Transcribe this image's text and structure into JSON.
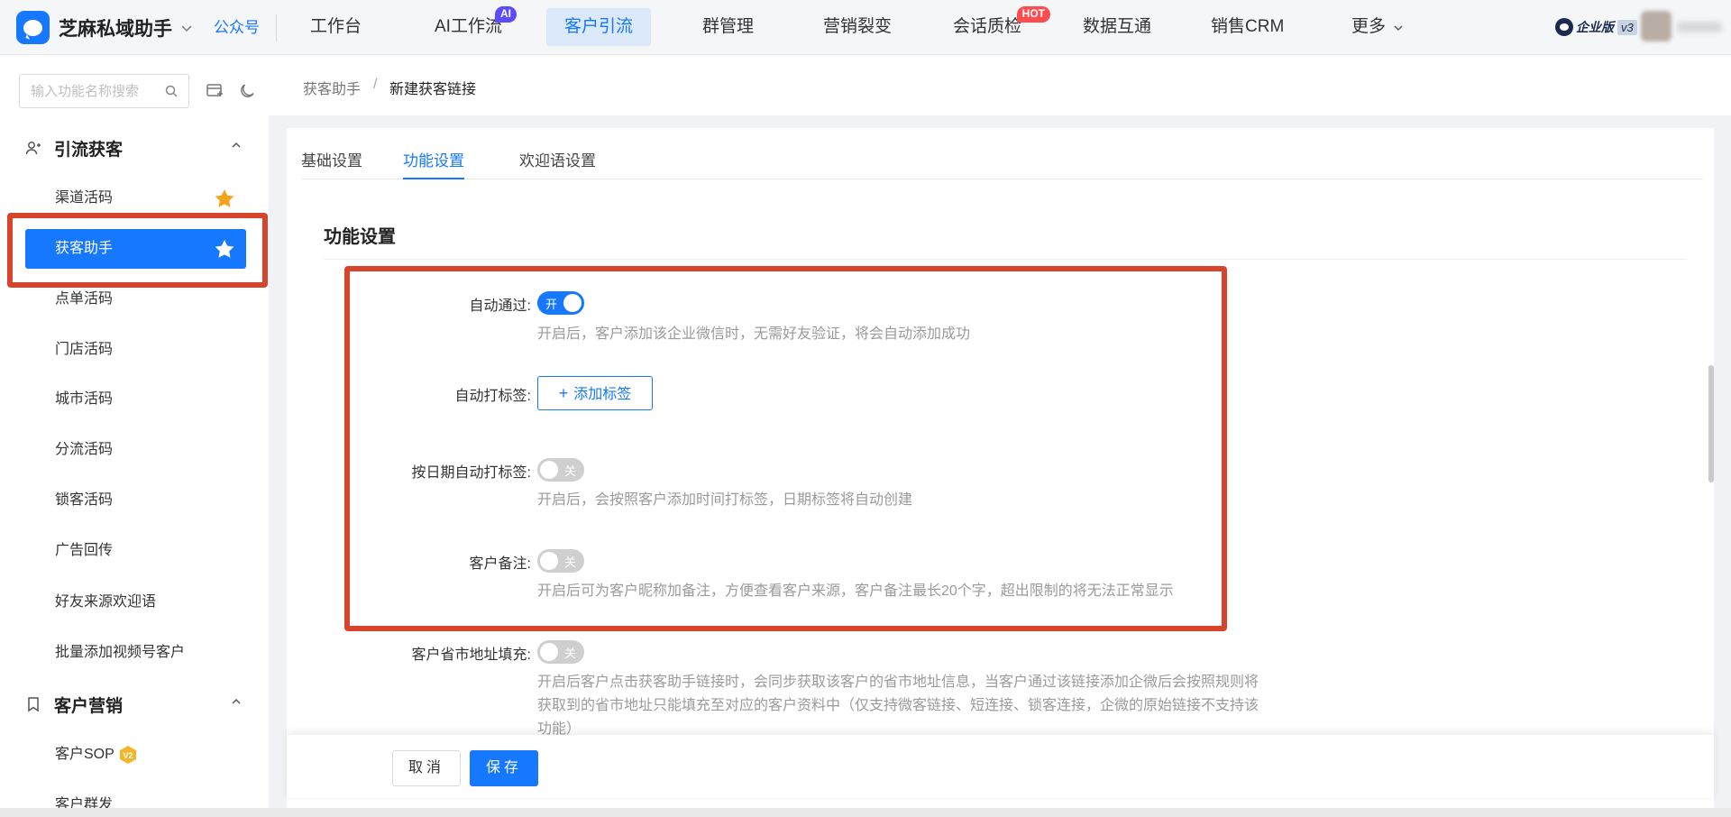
{
  "brand": {
    "name": "芝麻私域助手",
    "public_account": "公众号"
  },
  "nav": {
    "items": [
      {
        "label": "工作台"
      },
      {
        "label": "AI工作流",
        "badge": "AI"
      },
      {
        "label": "客户引流",
        "active": true
      },
      {
        "label": "群管理"
      },
      {
        "label": "营销裂变"
      },
      {
        "label": "会话质检",
        "badge": "HOT"
      },
      {
        "label": "数据互通"
      },
      {
        "label": "销售CRM"
      },
      {
        "label": "更多"
      }
    ]
  },
  "edition": {
    "label": "企业版",
    "version": "v3"
  },
  "sidebar": {
    "search": {
      "placeholder": "输入功能名称搜索",
      "value": ""
    },
    "groups": [
      {
        "title": "引流获客",
        "items": [
          {
            "label": "渠道活码",
            "starred": true
          },
          {
            "label": "获客助手",
            "active": true,
            "starred": true
          },
          {
            "label": "点单活码"
          },
          {
            "label": "门店活码"
          },
          {
            "label": "城市活码"
          },
          {
            "label": "分流活码"
          },
          {
            "label": "锁客活码"
          },
          {
            "label": "广告回传"
          },
          {
            "label": "好友来源欢迎语"
          },
          {
            "label": "批量添加视频号客户"
          }
        ]
      },
      {
        "title": "客户营销",
        "items": [
          {
            "label": "客户SOP",
            "badge": "V2"
          },
          {
            "label": "客户群发"
          }
        ]
      }
    ]
  },
  "breadcrumb": {
    "parent": "获客助手",
    "separator": "/",
    "current": "新建获客链接"
  },
  "tabs": [
    {
      "label": "基础设置"
    },
    {
      "label": "功能设置",
      "active": true
    },
    {
      "label": "欢迎语设置"
    }
  ],
  "section": {
    "title": "功能设置",
    "rows": [
      {
        "label": "自动通过:",
        "switch_on": true,
        "switch_text": "开",
        "desc": "开启后，客户添加该企业微信时，无需好友验证，将会自动添加成功"
      },
      {
        "label": "自动打标签:",
        "button": "添加标签"
      },
      {
        "label": "按日期自动打标签:",
        "switch_on": false,
        "switch_text": "关",
        "desc": "开启后，会按照客户添加时间打标签，日期标签将自动创建"
      },
      {
        "label": "客户备注:",
        "switch_on": false,
        "switch_text": "关",
        "desc": "开启后可为客户昵称加备注，方便查看客户来源，客户备注最长20个字，超出限制的将无法正常显示"
      },
      {
        "label": "客户省市地址填充:",
        "switch_on": false,
        "switch_text": "关",
        "desc_lines": [
          "开启后客户点击获客助手链接时，会同步获取该客户的省市地址信息，当客户通过该链接添加企微后会按照规则将",
          "获取到的省市地址只能填充至对应的客户资料中（仅支持微客链接、短连接、锁客连接，企微的原始链接不支持该",
          "功能）"
        ]
      }
    ]
  },
  "footer": {
    "cancel": "取消",
    "save": "保存"
  },
  "colors": {
    "primary": "#1677ff",
    "highlight": "#d8432c",
    "star": "#f7a21b"
  }
}
